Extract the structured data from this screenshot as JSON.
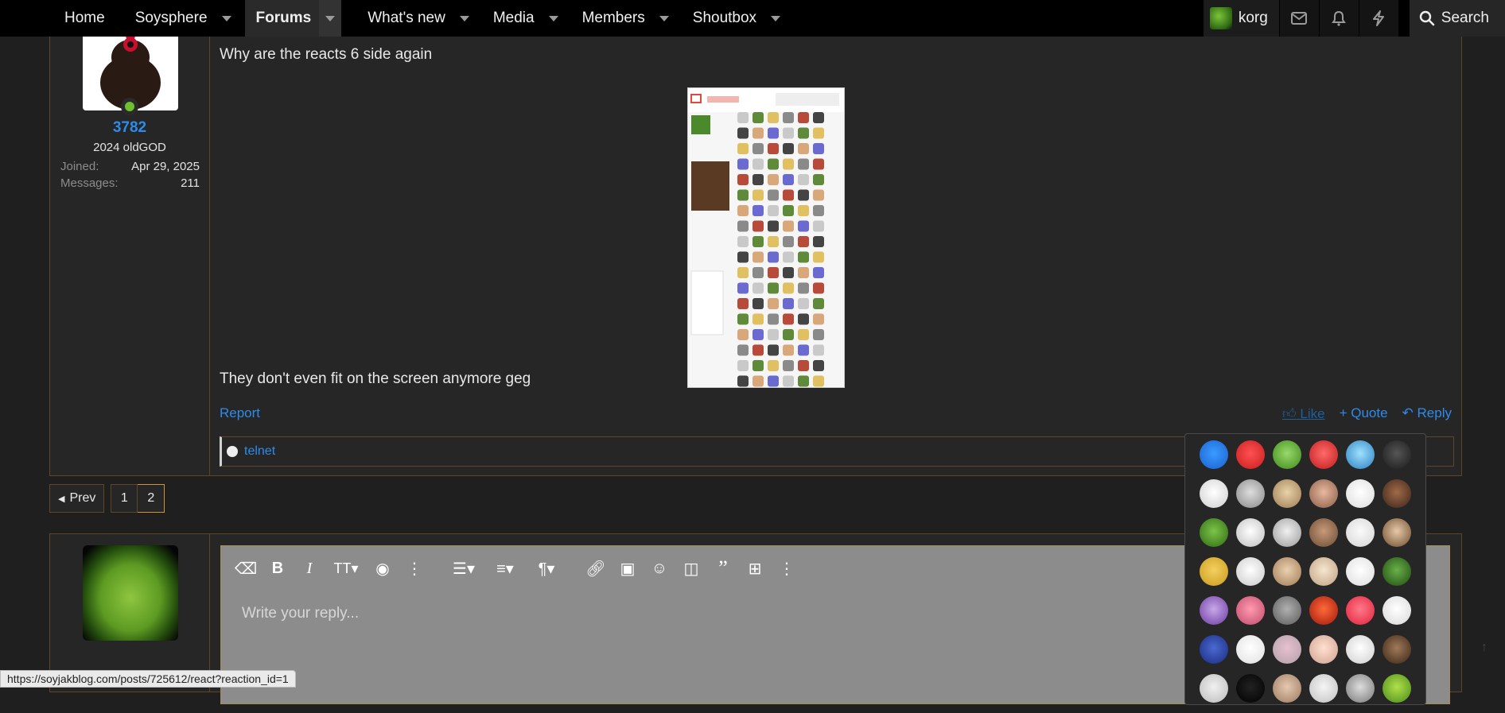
{
  "nav": {
    "tabs": [
      {
        "label": "Home",
        "has_menu": false
      },
      {
        "label": "Soysphere",
        "has_menu": true
      },
      {
        "label": "Forums",
        "has_menu": true,
        "active": true
      },
      {
        "label": "What's new",
        "has_menu": true
      },
      {
        "label": "Media",
        "has_menu": true
      },
      {
        "label": "Members",
        "has_menu": true
      },
      {
        "label": "Shoutbox",
        "has_menu": true
      }
    ],
    "user": "korg",
    "search_label": "Search"
  },
  "post": {
    "author": {
      "name": "3782",
      "title": "2024 oldGOD",
      "joined_label": "Joined:",
      "joined": "Apr 29, 2025",
      "messages_label": "Messages:",
      "messages": "211"
    },
    "text_line_1": "Why are the reacts 6 side again",
    "text_line_2": "They don't even fit on the screen anymore geg",
    "report_label": "Report",
    "like_label": "Like",
    "quote_label": "+ Quote",
    "reply_label": "Reply",
    "reacted_by": "telnet"
  },
  "pagination": {
    "prev_label": "Prev",
    "pages": [
      "1",
      "2"
    ],
    "current": "2"
  },
  "reply_editor": {
    "placeholder": "Write your reply..."
  },
  "status_url": "https://soyjakblog.com/posts/725612/react?reaction_id=1",
  "colors": {
    "accent": "#2f8bea",
    "border_gold": "#5c4624",
    "page_bg": "#1f1f1f",
    "panel_bg": "#262626"
  }
}
